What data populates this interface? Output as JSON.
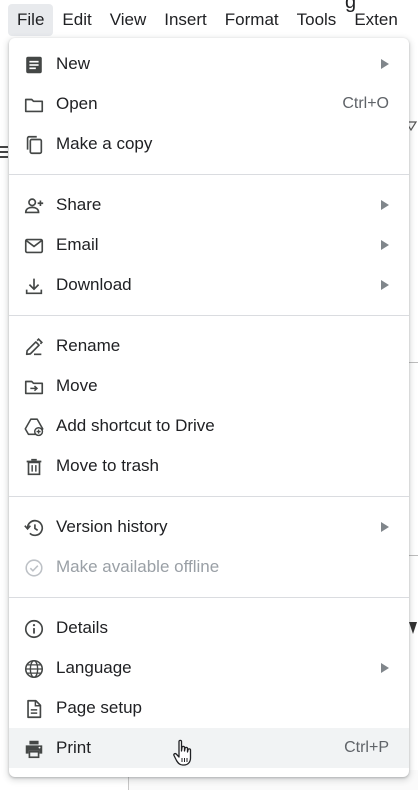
{
  "menubar": {
    "items": [
      "File",
      "Edit",
      "View",
      "Insert",
      "Format",
      "Tools",
      "Exten"
    ]
  },
  "background": {
    "top_text": "g"
  },
  "file_menu": {
    "items": [
      {
        "label": "New",
        "icon": "document-icon",
        "submenu": true
      },
      {
        "label": "Open",
        "icon": "folder-icon",
        "shortcut": "Ctrl+O"
      },
      {
        "label": "Make a copy",
        "icon": "copy-icon"
      },
      {
        "label": "Share",
        "icon": "person-add-icon",
        "submenu": true
      },
      {
        "label": "Email",
        "icon": "mail-icon",
        "submenu": true
      },
      {
        "label": "Download",
        "icon": "download-icon",
        "submenu": true
      },
      {
        "label": "Rename",
        "icon": "rename-pencil-icon"
      },
      {
        "label": "Move",
        "icon": "move-folder-icon"
      },
      {
        "label": "Add shortcut to Drive",
        "icon": "drive-shortcut-icon"
      },
      {
        "label": "Move to trash",
        "icon": "trash-icon"
      },
      {
        "label": "Version history",
        "icon": "history-icon",
        "submenu": true
      },
      {
        "label": "Make available offline",
        "icon": "offline-check-icon",
        "disabled": true
      },
      {
        "label": "Details",
        "icon": "info-icon"
      },
      {
        "label": "Language",
        "icon": "globe-icon",
        "submenu": true
      },
      {
        "label": "Page setup",
        "icon": "page-setup-icon"
      },
      {
        "label": "Print",
        "icon": "printer-icon",
        "shortcut": "Ctrl+P",
        "hovered": true
      }
    ]
  },
  "colors": {
    "text": "#202124",
    "secondary": "#5f6368",
    "disabled": "#9aa0a6",
    "hover": "#f1f3f4",
    "divider": "#dadce0"
  }
}
